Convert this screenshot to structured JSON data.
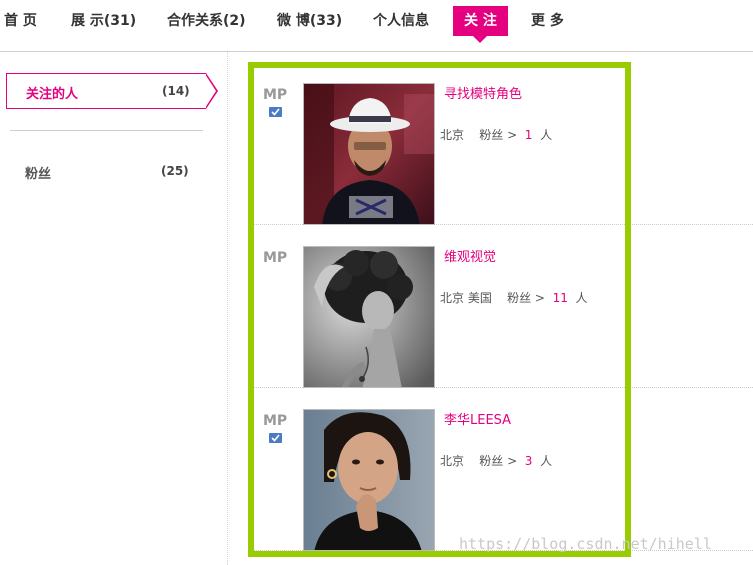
{
  "nav": {
    "items": [
      {
        "label": "首 页"
      },
      {
        "label": "展 示(31)"
      },
      {
        "label": "合作关系(2)"
      },
      {
        "label": "微 博(33)"
      },
      {
        "label": "个人信息"
      },
      {
        "label": "关 注",
        "active": true
      },
      {
        "label": "更 多"
      }
    ]
  },
  "sidebar": {
    "items": [
      {
        "label": "关注的人",
        "count": "(14)",
        "active": true
      },
      {
        "label": "粉丝",
        "count": "(25)"
      }
    ]
  },
  "list": {
    "rows": [
      {
        "badge": "MP",
        "verified": true,
        "name": "寻找模特角色",
        "location": "北京",
        "fans_label": "粉丝 >",
        "fans_count": "1",
        "unit": "人",
        "photo": "man-white-hat-photo"
      },
      {
        "badge": "MP",
        "verified": false,
        "name": "维观视觉",
        "location": "北京  美国",
        "fans_label": "粉丝 >",
        "fans_count": "11",
        "unit": "人",
        "photo": "bw-woman-curly-hair-photo"
      },
      {
        "badge": "MP",
        "verified": true,
        "name": "李华LEESA",
        "location": "北京",
        "fans_label": "粉丝 >",
        "fans_count": "3",
        "unit": "人",
        "photo": "woman-portrait-photo"
      }
    ]
  },
  "watermark": "https://blog.csdn.net/hihell",
  "colors": {
    "accent": "#e4007f",
    "frame": "#99cc00",
    "verified": "#4a7cc4"
  }
}
